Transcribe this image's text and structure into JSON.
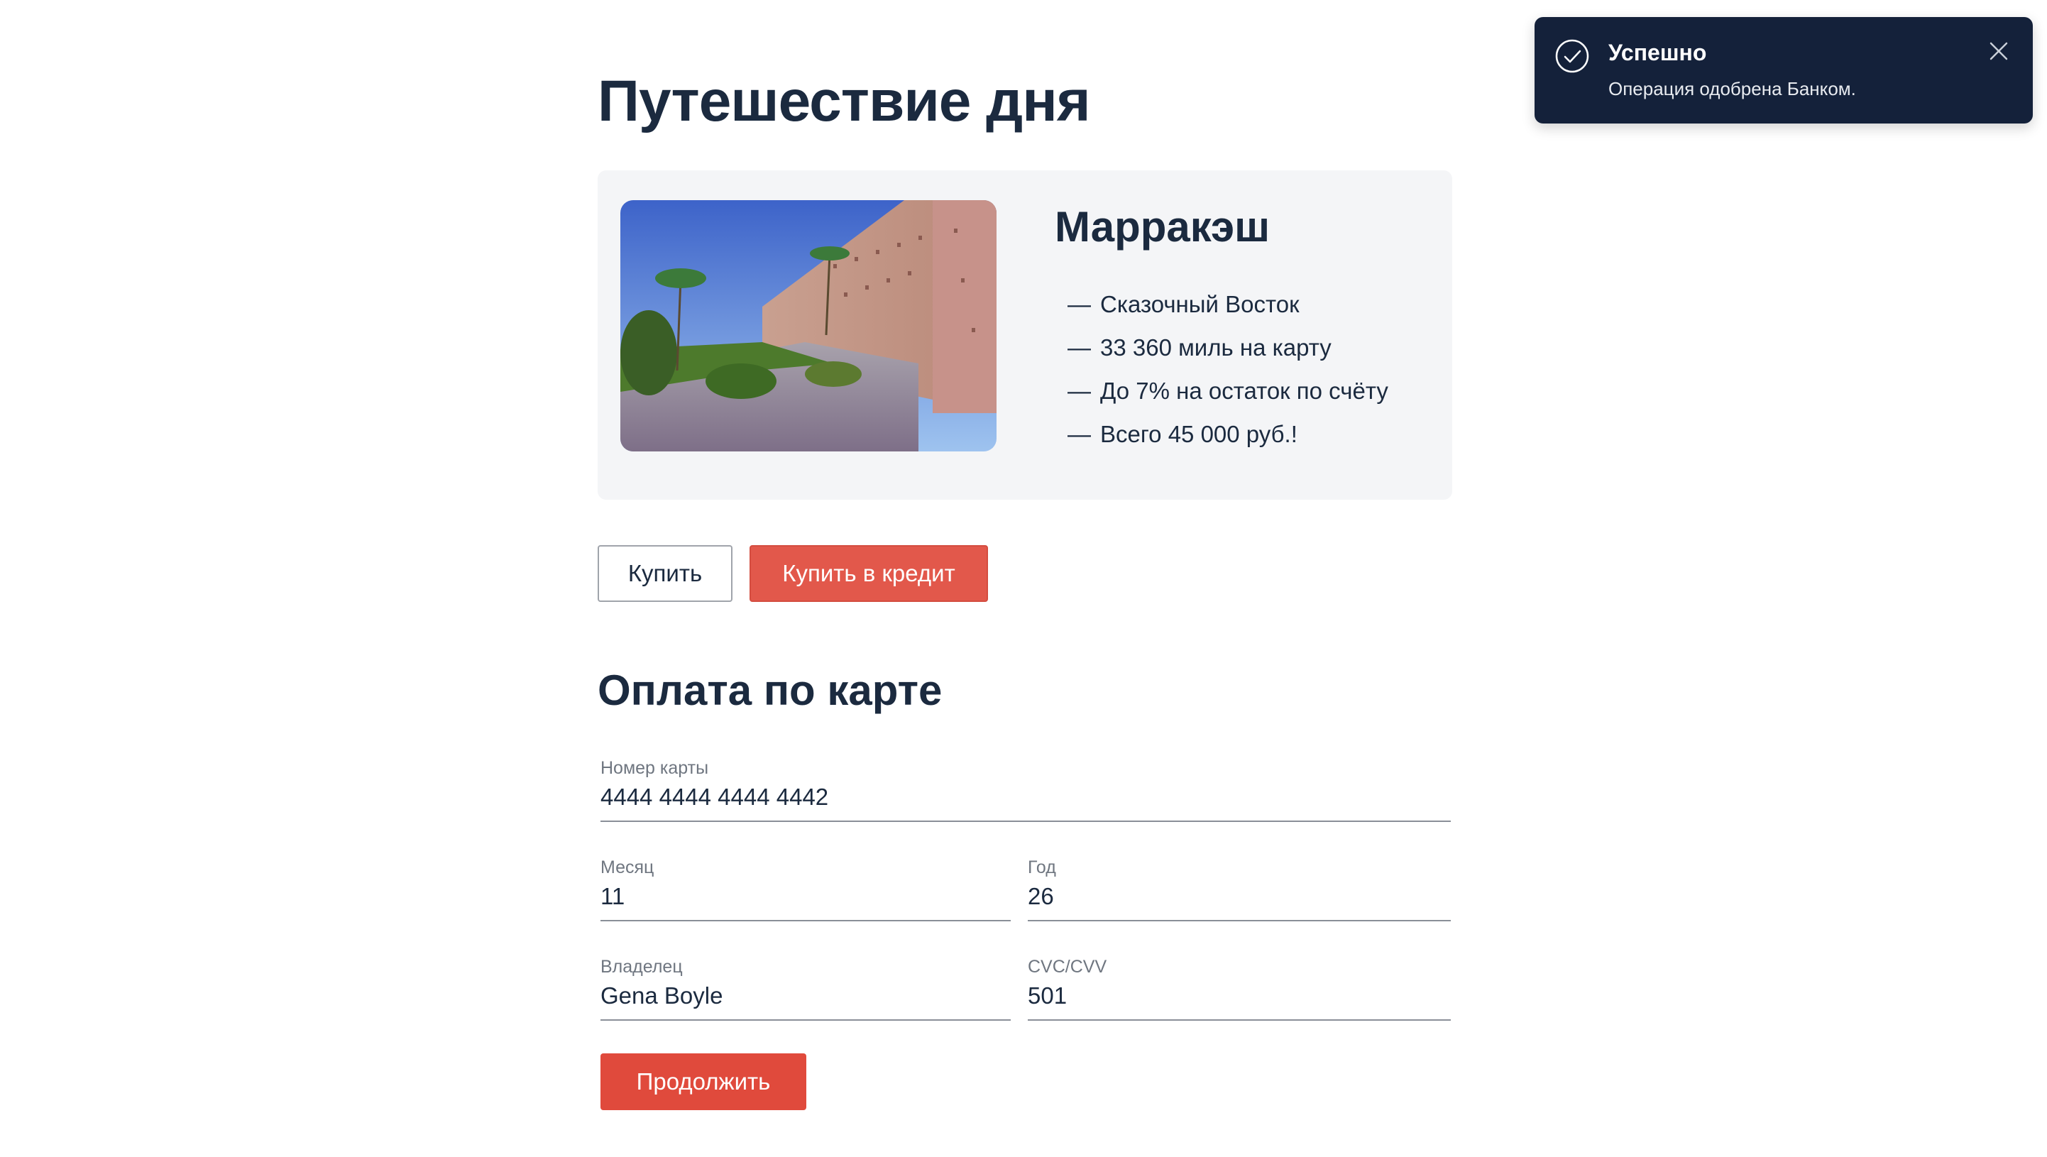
{
  "header": {
    "title": "Путешествие дня"
  },
  "trip": {
    "photo_icon": "marrakesh-wall-photo",
    "city": "Марракэш",
    "features": [
      "Сказочный Восток",
      "33 360 миль на карту",
      "До 7% на остаток по счёту",
      "Всего 45 000 руб.!"
    ],
    "dash": "—"
  },
  "actions": {
    "buy_label": "Купить",
    "credit_label": "Купить в кредит"
  },
  "payment": {
    "title": "Оплата по карте",
    "card_number": {
      "label": "Номер карты",
      "value": "4444 4444 4444 4442"
    },
    "month": {
      "label": "Месяц",
      "value": "11"
    },
    "year": {
      "label": "Год",
      "value": "26"
    },
    "owner": {
      "label": "Владелец",
      "value": "Gena Boyle"
    },
    "cvc": {
      "label": "CVC/CVV",
      "value": "501"
    },
    "continue_label": "Продолжить"
  },
  "notification": {
    "icon": "check-circle-icon",
    "title": "Успешно",
    "text": "Операция одобрена Банком.",
    "close_icon": "close-icon"
  },
  "colors": {
    "text": "#1b2a3f",
    "accent": "#e2584b",
    "card_bg": "#f4f5f7",
    "toast_bg": "#14213a"
  }
}
